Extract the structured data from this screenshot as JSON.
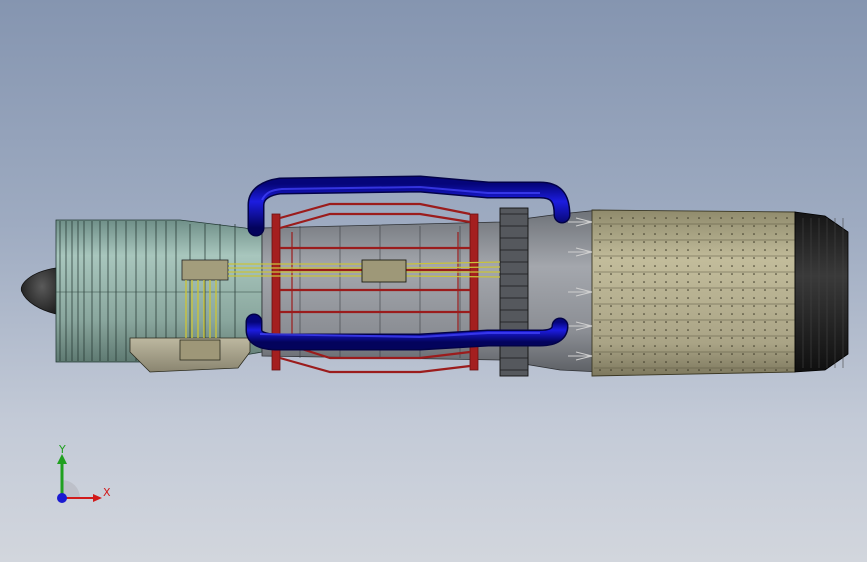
{
  "viewport": {
    "colors": {
      "background_top": "#8595b0",
      "background_bottom": "#d2d6dd",
      "intake_casing": "#8fb0a6",
      "compressor_casing": "#9bb4ac",
      "combustor_frame": "#9b1c1c",
      "coolant_pipe": "#0a0ab0",
      "fuel_lines": "#c9c33a",
      "perforated_shroud": "#b3ad8c",
      "nozzle": "#1c1c1c",
      "body_grey": "#8c8f95"
    }
  },
  "triad": {
    "x_label": "X",
    "y_label": "Y",
    "colors": {
      "x": "#d11a1a",
      "y": "#20a020",
      "z": "#1a1ad1"
    }
  }
}
